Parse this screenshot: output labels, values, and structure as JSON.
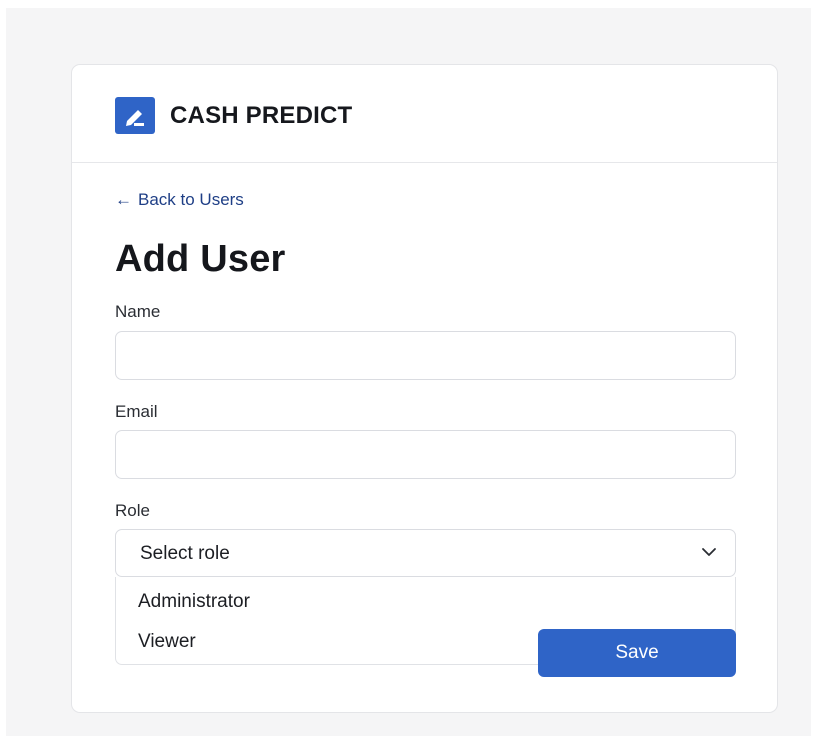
{
  "brand": {
    "name": "CASH PREDICT",
    "logo_icon": "pencil-square-icon",
    "color": "#2f64c7"
  },
  "nav": {
    "back_arrow": "←",
    "back_label": "Back to Users"
  },
  "page": {
    "title": "Add User"
  },
  "form": {
    "name": {
      "label": "Name",
      "value": "",
      "placeholder": ""
    },
    "email": {
      "label": "Email",
      "value": "",
      "placeholder": ""
    },
    "role": {
      "label": "Role",
      "selected": "Select role",
      "options": [
        "Administrator",
        "Viewer"
      ]
    },
    "save_label": "Save"
  },
  "colors": {
    "primary": "#2f64c7",
    "link": "#1f3f86",
    "border": "#dadce1",
    "background": "#f5f5f6"
  }
}
